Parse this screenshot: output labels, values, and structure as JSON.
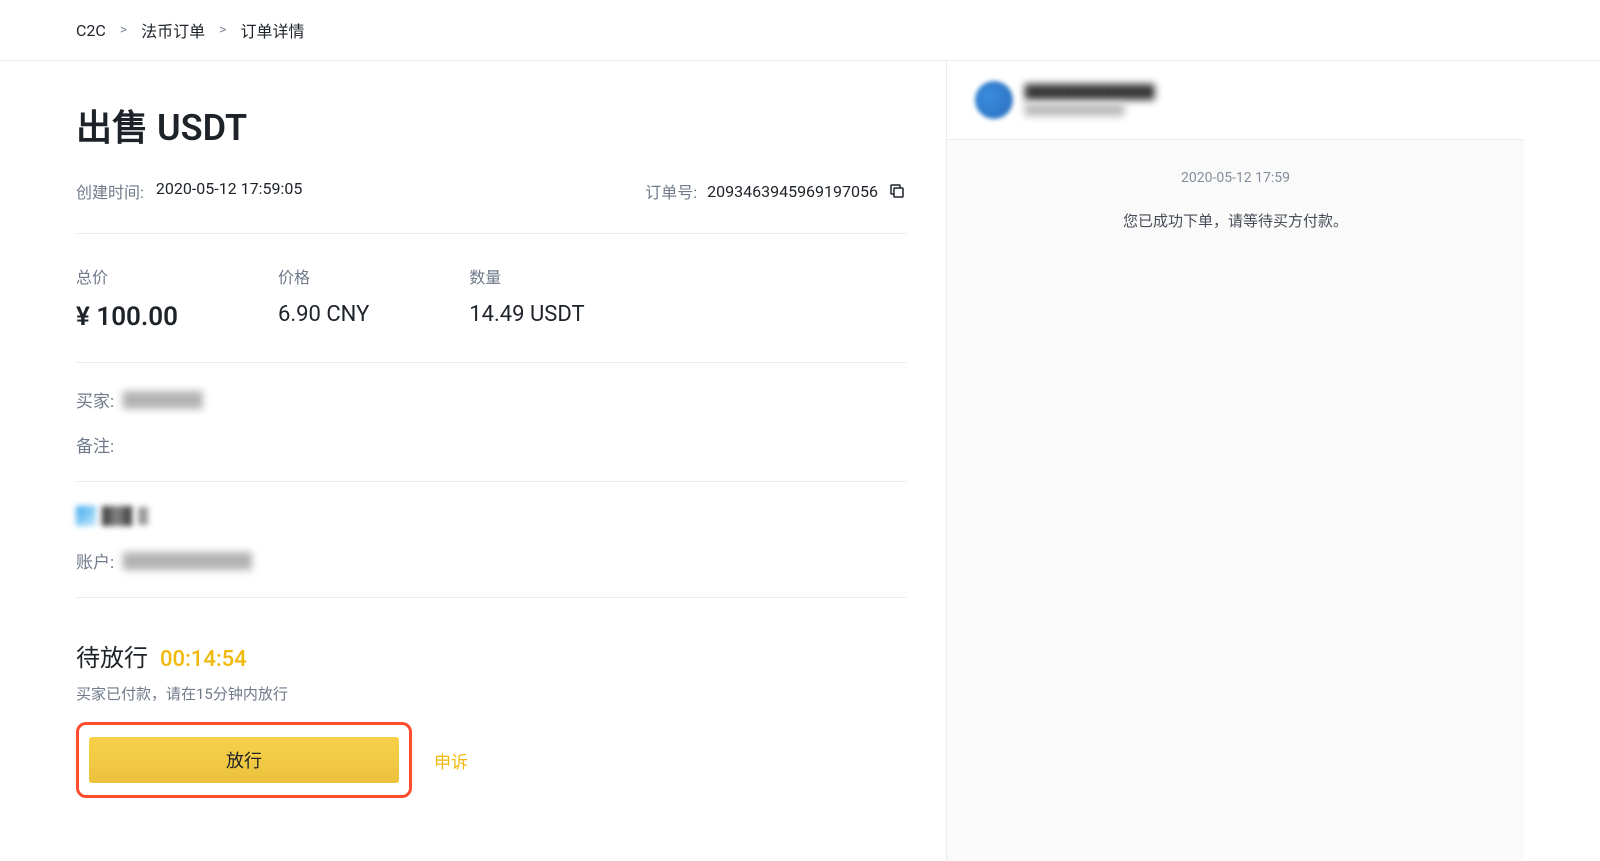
{
  "breadcrumb": {
    "item1": "C2C",
    "item2": "法币订单",
    "item3": "订单详情"
  },
  "page": {
    "title": "出售 USDT"
  },
  "meta": {
    "created_label": "创建时间:",
    "created_value": "2020-05-12 17:59:05",
    "order_label": "订单号:",
    "order_value": "2093463945969197056"
  },
  "stats": {
    "total_label": "总价",
    "total_value": "¥ 100.00",
    "price_label": "价格",
    "price_value": "6.90 CNY",
    "qty_label": "数量",
    "qty_value": "14.49 USDT"
  },
  "info": {
    "buyer_label": "买家:",
    "remark_label": "备注:",
    "account_label": "账户:"
  },
  "status": {
    "text": "待放行",
    "timer": "00:14:54",
    "hint": "买家已付款，请在15分钟内放行"
  },
  "actions": {
    "release": "放行",
    "appeal": "申诉"
  },
  "chat": {
    "timestamp": "2020-05-12 17:59",
    "message": "您已成功下单，请等待买方付款。"
  }
}
